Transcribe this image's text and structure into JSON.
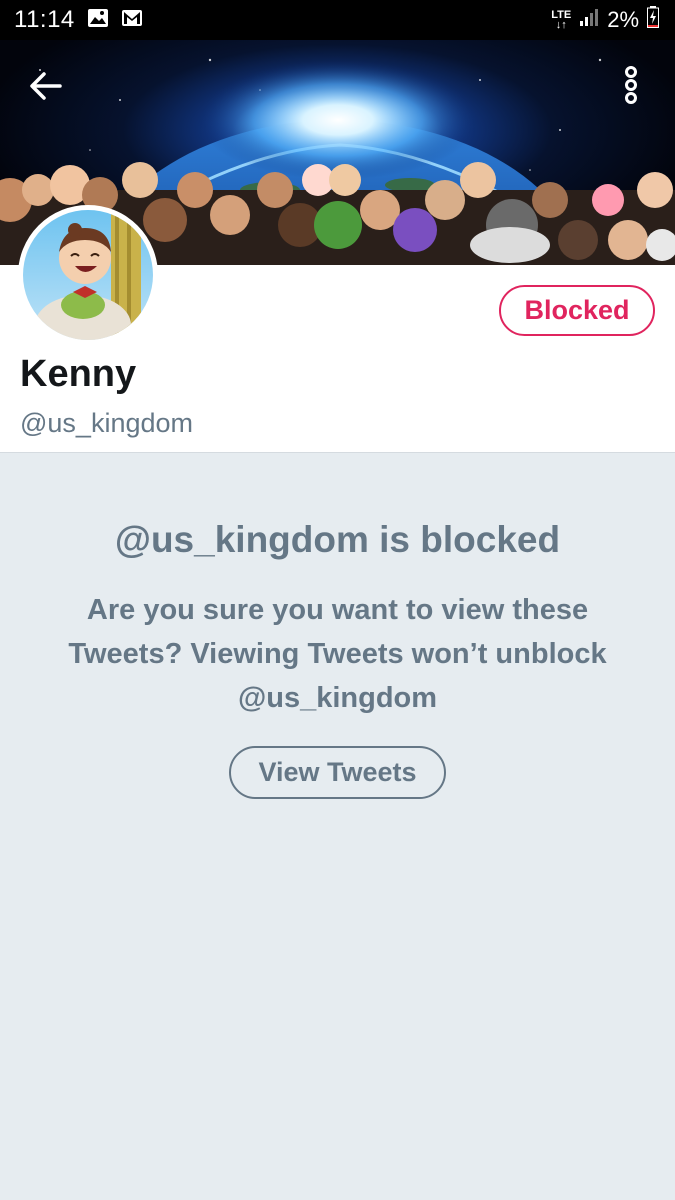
{
  "status_bar": {
    "time": "11:14",
    "network": "LTE",
    "battery": "2%",
    "icons": [
      "image-notification-icon",
      "gmail-notification-icon",
      "signal-icon",
      "battery-charging-icon"
    ]
  },
  "header": {
    "back_icon": "arrow-left-icon",
    "more_icon": "more-vertical-icon"
  },
  "profile": {
    "name": "Kenny",
    "handle": "@us_kingdom",
    "blocked_button_label": "Blocked"
  },
  "blocked_notice": {
    "title": "@us_kingdom is blocked",
    "message": "Are you sure you want to view these Tweets? Viewing Tweets won’t unblock @us_kingdom",
    "view_button_label": "View Tweets"
  },
  "colors": {
    "accent_blocked": "#e0245e",
    "secondary_text": "#657786",
    "primary_text": "#14171a",
    "panel_background": "#e6ecf0"
  }
}
